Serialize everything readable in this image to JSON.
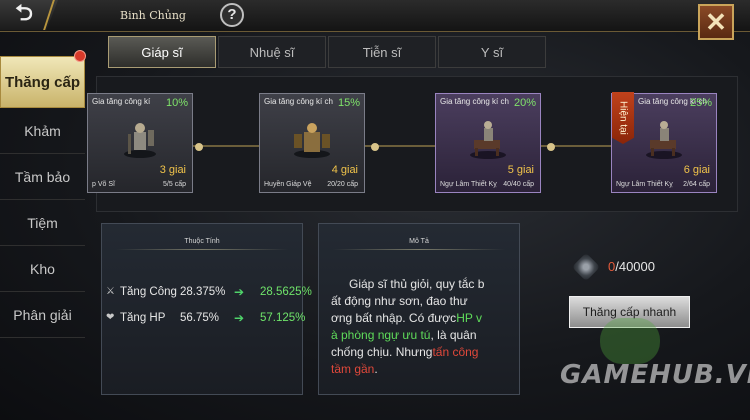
{
  "topbar": {
    "title": "Binh Chủng",
    "back_icon": "back-arrow-icon",
    "help_label": "?",
    "close_label": "✕"
  },
  "sidebar": {
    "items": [
      {
        "label": "Thăng cấp"
      },
      {
        "label": "Khảm"
      },
      {
        "label": "Tầm bảo"
      },
      {
        "label": "Tiệm"
      },
      {
        "label": "Kho"
      },
      {
        "label": "Phân giải"
      }
    ]
  },
  "tabs": [
    {
      "label": "Giáp sĩ"
    },
    {
      "label": "Nhuệ sĩ"
    },
    {
      "label": "Tiễn sĩ"
    },
    {
      "label": "Y sĩ"
    }
  ],
  "tiers": [
    {
      "title": "Gia tăng công kí",
      "pct": "10%",
      "tier": "3 giai",
      "name": "p Võ Sĩ",
      "level": "5/5 cấp"
    },
    {
      "title": "Gia tăng công kí ch",
      "pct": "15%",
      "tier": "4 giai",
      "name": "Huyền Giáp Vệ",
      "level": "20/20 cấp"
    },
    {
      "title": "Gia tăng công kí ch",
      "pct": "20%",
      "tier": "5 giai",
      "name": "Ngự Lâm Thiết Kỵ",
      "level": "40/40 cấp"
    },
    {
      "title": "Gia tăng công kí ch",
      "pct": "25%",
      "tier": "6 giai",
      "name": "Ngự Lâm Thiết Kỵ",
      "level": "2/64 cấp"
    }
  ],
  "current_badge": "Hiện tại",
  "attributes": {
    "header": "Thuộc Tính",
    "rows": [
      {
        "icon": "swords-icon",
        "label": "Tăng Công",
        "value": "28.375%",
        "new_value": "28.5625%"
      },
      {
        "icon": "heart-icon",
        "label": "Tăng HP",
        "value": "56.75%",
        "new_value": "57.125%"
      }
    ]
  },
  "description": {
    "header": "Mô Tả",
    "line1": "Giáp sĩ thủ giỏi, quy tắc b",
    "line2": "ất động như sơn, đao thư",
    "line3": "ơng bất nhập. Có được",
    "hl1": "HP v",
    "line4_green": "à phòng ngự ưu tú",
    "line4_rest": ", là quân",
    "line5": "chống chịu. Nhưng",
    "hl2": "tấn công",
    "line6_red": "tầm gần",
    "line6_rest": "."
  },
  "resource": {
    "current": "0",
    "total": "/40000"
  },
  "upgrade_button": "Thăng cấp nhanh",
  "watermark": "GAMEHUB.VN",
  "colors": {
    "accent_gold": "#c9a45a",
    "green_value": "#6fe46a",
    "red_value": "#e35a3a"
  }
}
